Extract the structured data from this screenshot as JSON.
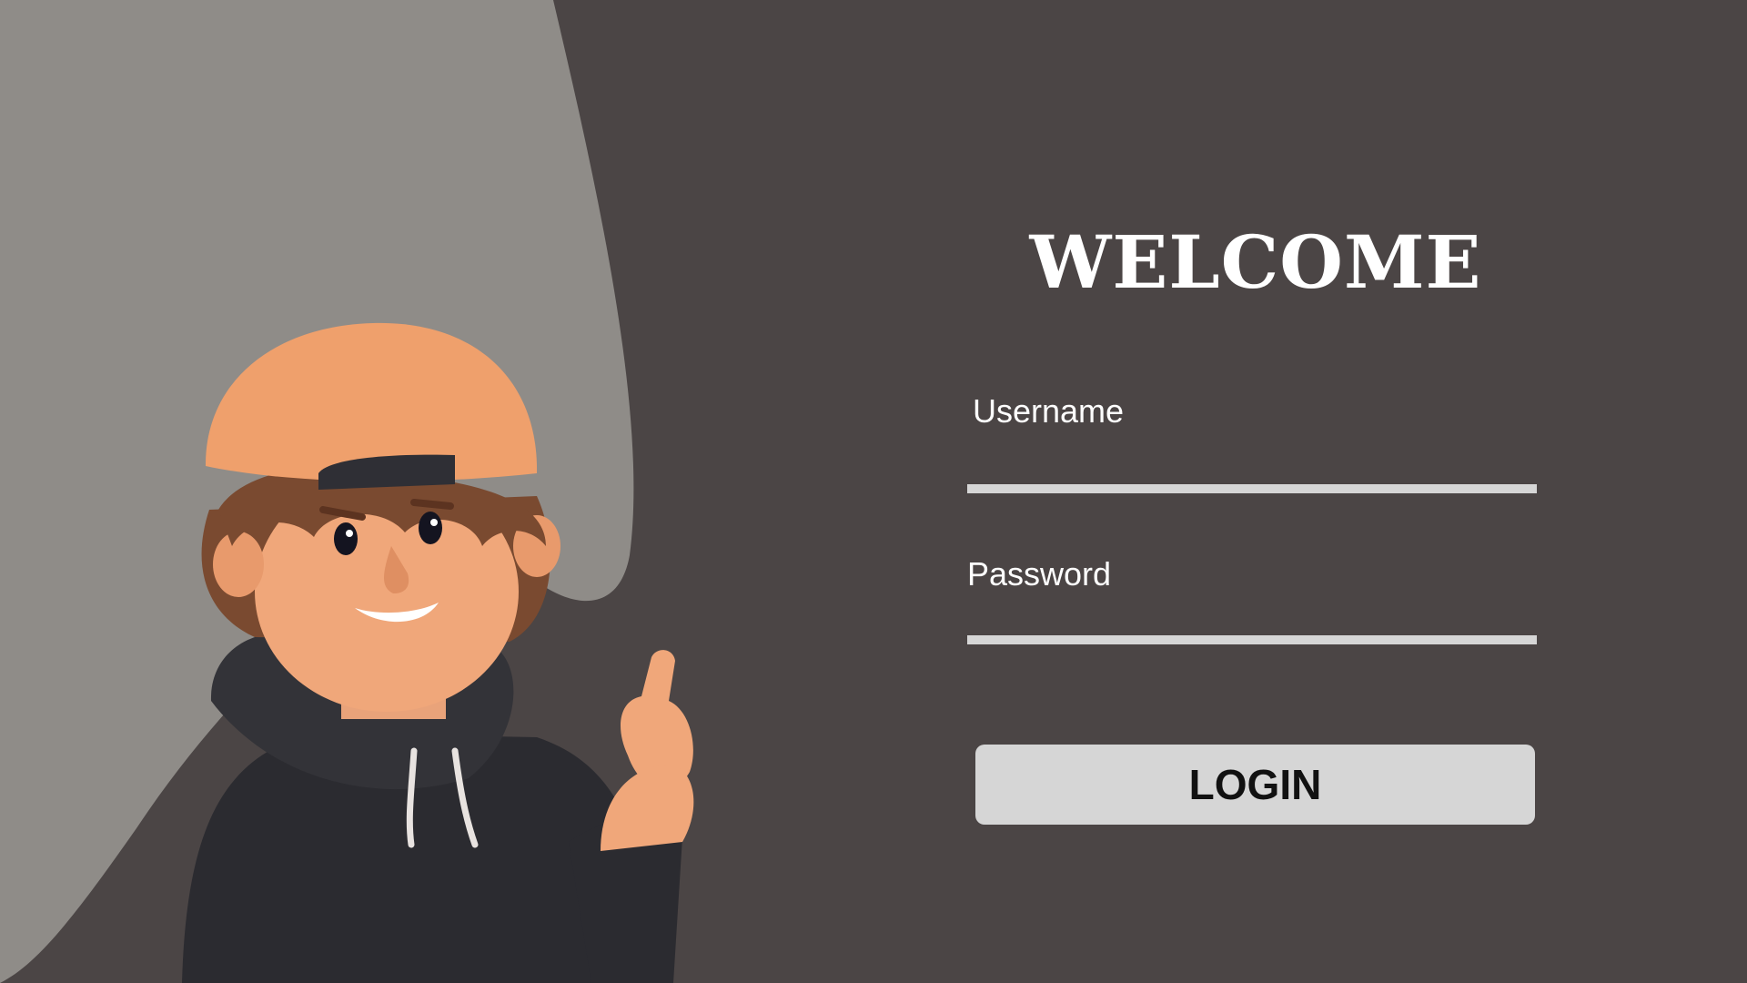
{
  "colors": {
    "background": "#4b4545",
    "blob": "#8f8c88",
    "field_line": "#d6d6d6",
    "button_bg": "#d6d6d6",
    "button_text": "#111111",
    "text": "#ffffff"
  },
  "header": {
    "title": "WELCOME"
  },
  "form": {
    "username": {
      "label": "Username",
      "value": "",
      "placeholder": ""
    },
    "password": {
      "label": "Password",
      "value": "",
      "placeholder": ""
    },
    "login_label": "LOGIN"
  },
  "illustration": {
    "subject": "3D cartoon boy in backwards orange cap and black hoodie pointing up"
  }
}
